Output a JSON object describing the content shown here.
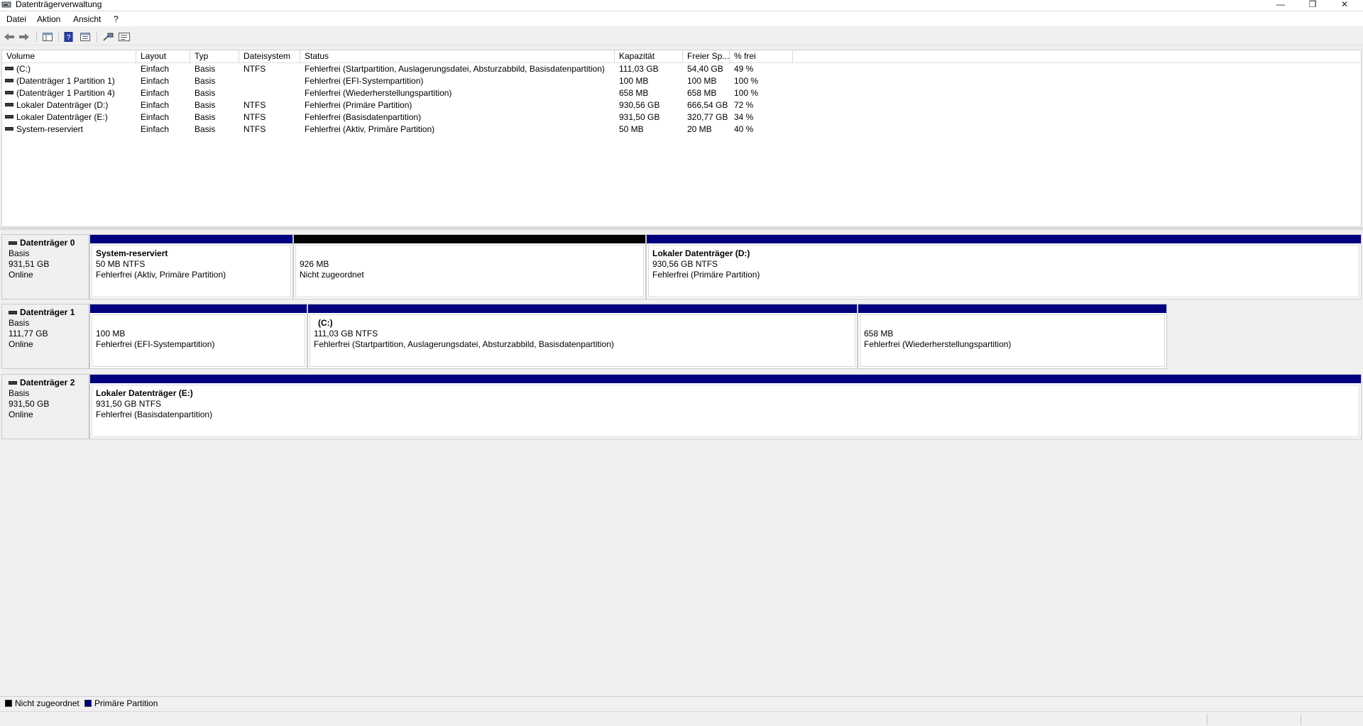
{
  "window": {
    "title": "Datenträgerverwaltung",
    "minimize": "—",
    "restore": "❐",
    "close": "✕"
  },
  "menu": {
    "items": [
      "Datei",
      "Aktion",
      "Ansicht",
      "?"
    ]
  },
  "toolbar": {
    "buttons": [
      "back-icon",
      "forward-icon",
      "console-tree-icon",
      "help-icon",
      "properties-icon",
      "connect-icon",
      "list-icon"
    ]
  },
  "volume_list": {
    "columns": [
      "Volume",
      "Layout",
      "Typ",
      "Dateisystem",
      "Status",
      "Kapazität",
      "Freier Sp...",
      "% frei"
    ],
    "rows": [
      [
        "(C:)",
        "Einfach",
        "Basis",
        "NTFS",
        "Fehlerfrei (Startpartition, Auslagerungsdatei, Absturzabbild, Basisdatenpartition)",
        "111,03 GB",
        "54,40 GB",
        "49 %"
      ],
      [
        "(Datenträger 1 Partition 1)",
        "Einfach",
        "Basis",
        "",
        "Fehlerfrei (EFI-Systempartition)",
        "100 MB",
        "100 MB",
        "100 %"
      ],
      [
        "(Datenträger 1 Partition 4)",
        "Einfach",
        "Basis",
        "",
        "Fehlerfrei (Wiederherstellungspartition)",
        "658 MB",
        "658 MB",
        "100 %"
      ],
      [
        "Lokaler Datenträger (D:)",
        "Einfach",
        "Basis",
        "NTFS",
        "Fehlerfrei (Primäre Partition)",
        "930,56 GB",
        "666,54 GB",
        "72 %"
      ],
      [
        "Lokaler Datenträger (E:)",
        "Einfach",
        "Basis",
        "NTFS",
        "Fehlerfrei (Basisdatenpartition)",
        "931,50 GB",
        "320,77 GB",
        "34 %"
      ],
      [
        "System-reserviert",
        "Einfach",
        "Basis",
        "NTFS",
        "Fehlerfrei (Aktiv, Primäre Partition)",
        "50 MB",
        "20 MB",
        "40 %"
      ]
    ]
  },
  "disks": [
    {
      "name": "Datenträger 0",
      "type": "Basis",
      "size": "931,51 GB",
      "state": "Online",
      "partitions": [
        {
          "name": "System-reserviert",
          "size": "50 MB NTFS",
          "status": "Fehlerfrei (Aktiv, Primäre Partition)",
          "kind": "primary"
        },
        {
          "name": "",
          "size": "926 MB",
          "status": "Nicht zugeordnet",
          "kind": "unallocated"
        },
        {
          "name": "Lokaler Datenträger  (D:)",
          "size": "930,56 GB NTFS",
          "status": "Fehlerfrei (Primäre Partition)",
          "kind": "primary"
        }
      ]
    },
    {
      "name": "Datenträger 1",
      "type": "Basis",
      "size": "111,77 GB",
      "state": "Online",
      "partitions": [
        {
          "name": "",
          "size": "100 MB",
          "status": "Fehlerfrei (EFI-Systempartition)",
          "kind": "primary"
        },
        {
          "name": "(C:)",
          "size": "111,03 GB NTFS",
          "status": "Fehlerfrei (Startpartition, Auslagerungsdatei, Absturzabbild, Basisdatenpartition)",
          "kind": "primary"
        },
        {
          "name": "",
          "size": "658 MB",
          "status": "Fehlerfrei (Wiederherstellungspartition)",
          "kind": "primary"
        }
      ]
    },
    {
      "name": "Datenträger 2",
      "type": "Basis",
      "size": "931,50 GB",
      "state": "Online",
      "partitions": [
        {
          "name": "Lokaler Datenträger  (E:)",
          "size": "931,50 GB NTFS",
          "status": "Fehlerfrei (Basisdatenpartition)",
          "kind": "primary"
        }
      ]
    }
  ],
  "legend": {
    "unallocated": "Nicht zugeordnet",
    "primary": "Primäre Partition"
  },
  "colors": {
    "primary": "#00007f",
    "unallocated": "#000000"
  }
}
